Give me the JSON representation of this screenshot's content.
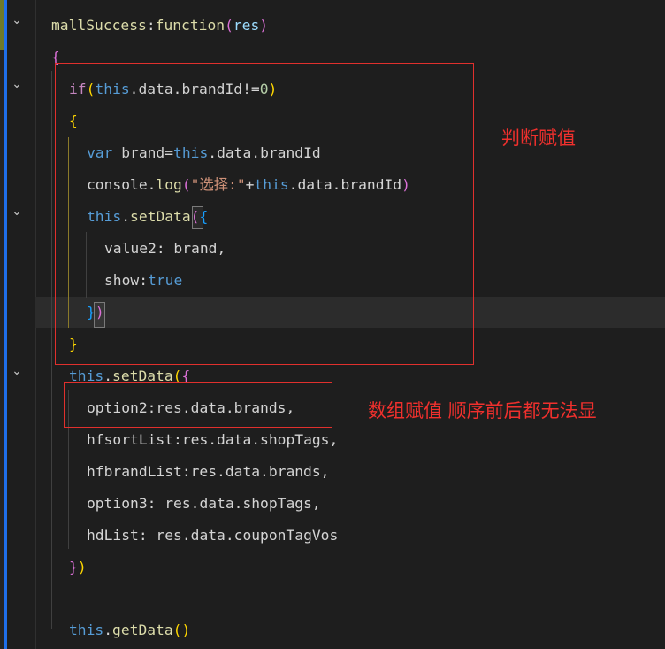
{
  "colors": {
    "background": "#1e1e1e",
    "keyword": "#569cd6",
    "function": "#dcdcaa",
    "property": "#9cdcfe",
    "string": "#ce9178",
    "number": "#b5cea8",
    "brace_yellow": "#ffd700",
    "brace_purple": "#da70d6",
    "plain": "#d4d4d4",
    "annotation_red": "#f0302d"
  },
  "fold_icons": [
    "chevron-down-icon",
    "chevron-down-icon",
    "chevron-down-icon",
    "chevron-down-icon"
  ],
  "code": {
    "line1": {
      "name": "mallSuccess",
      "colon": ":",
      "kw": "function",
      "p1": "(",
      "param": "res",
      "p2": ")"
    },
    "line2": {
      "brace": "{"
    },
    "line3": {
      "kw": "if",
      "p1": "(",
      "this": "this",
      "rest": ".data.brandId!=",
      "num": "0",
      "p2": ")"
    },
    "line4": {
      "brace": "{"
    },
    "line5": {
      "kw": "var",
      "decl": " brand=",
      "this": "this",
      "rest": ".data.brandId"
    },
    "line6": {
      "obj": "console.",
      "fn": "log",
      "p1": "(",
      "str": "\"选择:\"",
      "plus": "+",
      "this": "this",
      "rest": ".data.brandId",
      "p2": ")"
    },
    "line7": {
      "this": "this",
      "dot": ".",
      "fn": "setData",
      "p": "(",
      "brace": "{"
    },
    "line8": {
      "key": "value2",
      "rest": ": brand,"
    },
    "line9": {
      "key": "show",
      "colon": ":",
      "val": "true"
    },
    "line10": {
      "brace": "}",
      "p": ")"
    },
    "line11": {
      "brace": "}"
    },
    "line12": {
      "this": "this",
      "dot": ".",
      "fn": "setData",
      "p": "(",
      "brace": "{"
    },
    "line13": {
      "key": "option2",
      "rest": ":res.data.brands,"
    },
    "line14": {
      "key": "hfsortList",
      "rest": ":res.data.shopTags,"
    },
    "line15": {
      "key": "hfbrandList",
      "rest": ":res.data.brands,"
    },
    "line16": {
      "key": "option3",
      "rest": ": res.data.shopTags,"
    },
    "line17": {
      "key": "hdList",
      "rest": ": res.data.couponTagVos"
    },
    "line18": {
      "brace": "}",
      "p": ")"
    },
    "line19": {
      "this": "this",
      "dot": ".",
      "fn": "getData",
      "p": "()"
    }
  },
  "annotations": {
    "judge_assign": "判断赋值",
    "array_assign": "数组赋值 顺序前后都无法显"
  }
}
